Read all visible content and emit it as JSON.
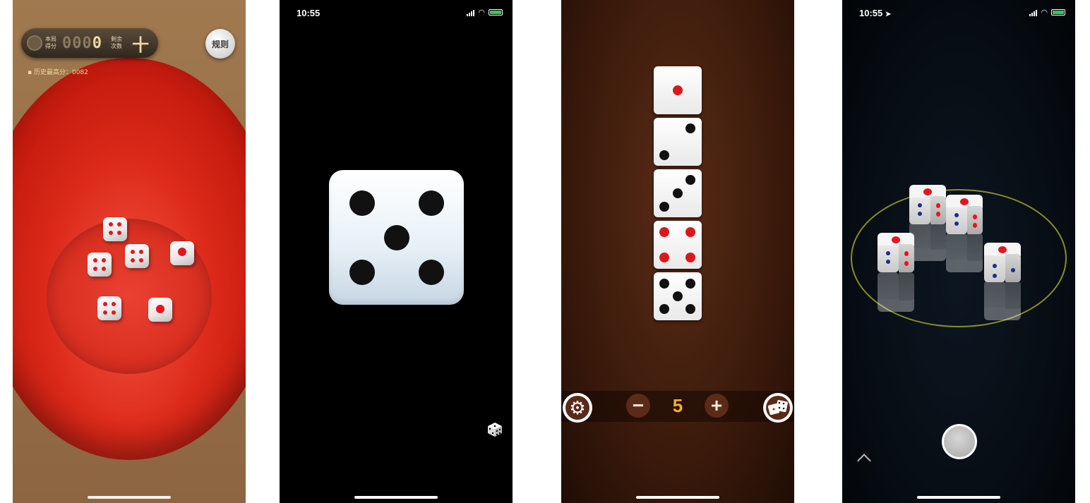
{
  "screen1": {
    "score_label_top": "本局",
    "score_label_bottom": "得分",
    "score_dim": "000",
    "score_bright": "0",
    "remaining_label_top": "剩余",
    "remaining_label_bottom": "次数",
    "remaining_value": "十",
    "rules_label": "规则",
    "best_score": "历史最高分：0082",
    "icons": {
      "gear": "gear-icon"
    }
  },
  "screen2": {
    "status_time": "10:55",
    "die_face": 5,
    "icons": {
      "dice": "dice-icon"
    }
  },
  "screen3": {
    "faces": [
      1,
      2,
      3,
      4,
      5
    ],
    "dice_count": "5",
    "minus_label": "−",
    "plus_label": "+",
    "icons": {
      "settings": "gear-icon",
      "roll": "dice-icon"
    }
  },
  "screen4": {
    "status_time": "10:55",
    "icons": {
      "location": "location-arrow-icon",
      "expand": "chevron-up-icon",
      "shutter": "shutter-button"
    }
  },
  "colors": {
    "bowl_red": "#dd2a1a",
    "pip_red": "#e8141c",
    "pip_blue": "#1b2e86",
    "counter_orange": "#f4b12a",
    "button_brown": "#5b2a18",
    "battery_green": "#34c759"
  }
}
